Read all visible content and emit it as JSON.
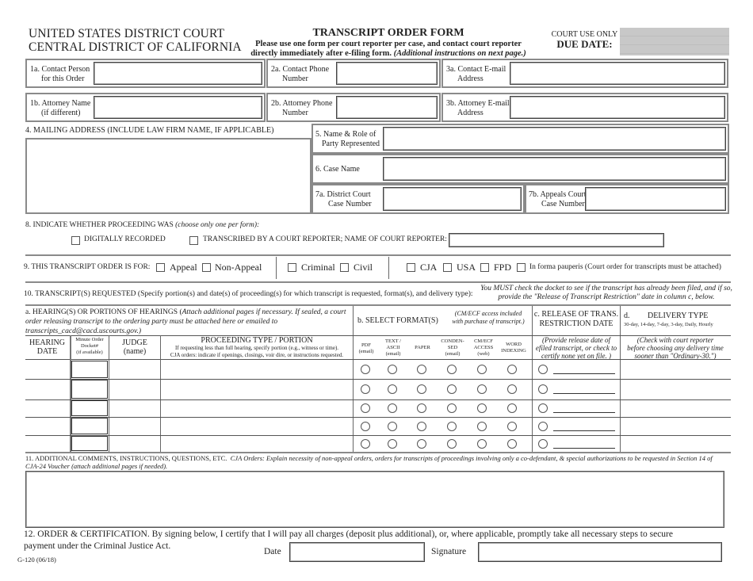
{
  "header": {
    "court_line1": "UNITED STATES DISTRICT COURT",
    "court_line2": "CENTRAL DISTRICT OF CALIFORNIA",
    "form_title": "TRANSCRIPT ORDER FORM",
    "instructions_line1": "Please use one form per court reporter per case, and contact court reporter",
    "instructions_line2": "directly immediately after e-filing form.",
    "instructions_italic": "(Additional instructions on next page.)",
    "court_use_only": "COURT USE ONLY",
    "due_date_label": "DUE DATE:"
  },
  "contact": {
    "f1a_line1": "1a.  Contact Person",
    "f1a_line2": "for this Order",
    "f2a_line1": "2a.  Contact Phone",
    "f2a_line2": "Number",
    "f3a_line1": "3a.  Contact E-mail",
    "f3a_line2": "Address",
    "f1b_line1": "1b.  Attorney Name",
    "f1b_line2": "(if different)",
    "f2b_line1": "2b.  Attorney Phone",
    "f2b_line2": "Number",
    "f3b_line1": "3b.  Attorney E-mail",
    "f3b_line2": "Address",
    "values": {
      "f1a": "",
      "f2a": "",
      "f3a": "",
      "f1b": "",
      "f2b": "",
      "f3b": ""
    }
  },
  "mailing": {
    "label": "4. MAILING ADDRESS (INCLUDE LAW FIRM NAME, IF APPLICABLE)",
    "value": ""
  },
  "party": {
    "f5_line1": "5. Name & Role of",
    "f5_line2": "Party Represented",
    "f6": "6.  Case Name",
    "f7a_line1": "7a.  District Court",
    "f7a_line2": "Case Number",
    "f7b_line1": "7b.  Appeals Court",
    "f7b_line2": "Case Number",
    "values": {
      "f5": "",
      "f6": "",
      "f7a": "",
      "f7b": ""
    }
  },
  "section8": {
    "label": "8.  INDICATE WHETHER PROCEEDING WAS",
    "label_italic": "(choose only one per form):",
    "opt_digital": "DIGITALLY RECORDED",
    "opt_reporter": "TRANSCRIBED BY A COURT REPORTER; NAME OF COURT REPORTER:",
    "reporter_name": "",
    "digital_checked": false,
    "reporter_checked": false
  },
  "section9": {
    "label": "9. THIS TRANSCRIPT ORDER IS FOR:",
    "options": [
      {
        "label": "Appeal",
        "checked": false
      },
      {
        "label": "Non-Appeal",
        "checked": false
      },
      {
        "label": "Criminal",
        "checked": false
      },
      {
        "label": "Civil",
        "checked": false
      },
      {
        "label": "CJA",
        "checked": false
      },
      {
        "label": "USA",
        "checked": false
      },
      {
        "label": "FPD",
        "checked": false
      },
      {
        "label": "In forma pauperis (Court order for transcripts must be attached)",
        "checked": false
      }
    ]
  },
  "section10": {
    "label": "10. TRANSCRIPT(S) REQUESTED (Specify portion(s) and date(s) of proceeding(s) for which transcript is requested, format(s), and delivery type):",
    "must_check_line1": "You MUST check the docket to see if the transcript has already been filed, and if so,",
    "must_check_line2": "provide the \"Release of Transcript Restriction\" date in column c, below.",
    "col_a_title": "a.  HEARING(S) OR PORTIONS OF HEARINGS (",
    "col_a_italic": "Attach additional pages if necessary.  If sealed, a court order releasing transcript to the ordering party must be attached here or emailed to transcripts_cacd@cacd.uscourts.gov.)",
    "col_b_title": "b.  SELECT FORMAT(S)",
    "col_b_note_line1": "(CM/ECF access included",
    "col_b_note_line2": "with purchase of transcript.)",
    "col_c_title_line1": "c.  RELEASE OF TRANS.",
    "col_c_title_line2": "RESTRICTION DATE",
    "col_d_title_letter": "d.",
    "col_d_title": "DELIVERY TYPE",
    "col_d_sub": "30-day, 14-day, 7-day, 3-day, Daily, Hourly",
    "headers": {
      "hearing_date_1": "HEARING",
      "hearing_date_2": "DATE",
      "minute_1": "Minute Order",
      "minute_2": "Docket#",
      "minute_3": "(if available)",
      "judge_1": "JUDGE",
      "judge_2": "(name)",
      "proc_title": "PROCEEDING TYPE / PORTION",
      "proc_sub1": "If requesting less than full hearing, specify portion (e.g., witness or time).",
      "proc_sub2": "CJA orders: indicate if openings, closings, voir dire, or instructions requested.",
      "pdf_1": "PDF",
      "pdf_2": "(email)",
      "text_1": "TEXT /",
      "text_2": "ASCII",
      "text_3": "(email)",
      "paper": "PAPER",
      "cond_1": "CONDEN-",
      "cond_2": "SED",
      "cond_3": "(email)",
      "cmecf_1": "CM/ECF",
      "cmecf_2": "ACCESS",
      "cmecf_3": "(web)",
      "word_1": "WORD",
      "word_2": "INDEXING",
      "release_1": "(Provide release date of",
      "release_2": "efiled transcript, or check to",
      "release_3": "certify none yet on file. )",
      "delivery_1": "(Check with court reporter",
      "delivery_2": "before choosing any delivery time",
      "delivery_3": "sooner than \"Ordinary-30.\")"
    },
    "rows": [
      {
        "hearing_date": "",
        "minute_order": "",
        "judge": "",
        "proceeding": "",
        "formats": [
          false,
          false,
          false,
          false,
          false,
          false
        ],
        "release_none": false,
        "release_date": "",
        "delivery": ""
      },
      {
        "hearing_date": "",
        "minute_order": "",
        "judge": "",
        "proceeding": "",
        "formats": [
          false,
          false,
          false,
          false,
          false,
          false
        ],
        "release_none": false,
        "release_date": "",
        "delivery": ""
      },
      {
        "hearing_date": "",
        "minute_order": "",
        "judge": "",
        "proceeding": "",
        "formats": [
          false,
          false,
          false,
          false,
          false,
          false
        ],
        "release_none": false,
        "release_date": "",
        "delivery": ""
      },
      {
        "hearing_date": "",
        "minute_order": "",
        "judge": "",
        "proceeding": "",
        "formats": [
          false,
          false,
          false,
          false,
          false,
          false
        ],
        "release_none": false,
        "release_date": "",
        "delivery": ""
      },
      {
        "hearing_date": "",
        "minute_order": "",
        "judge": "",
        "proceeding": "",
        "formats": [
          false,
          false,
          false,
          false,
          false,
          false
        ],
        "release_none": false,
        "release_date": "",
        "delivery": ""
      }
    ]
  },
  "section11": {
    "label": "11. ADDITIONAL COMMENTS, INSTRUCTIONS, QUESTIONS, ETC.",
    "label_italic": "CJA Orders:  Explain necessity of non-appeal orders, orders for transcripts of proceedings involving only a co-defendant, & special authorizations to be requested in Section 14 of CJA-24 Voucher (attach additional pages if needed).",
    "value": ""
  },
  "section12": {
    "text_line1": "12.  ORDER & CERTIFICATION.  By signing below, I certify that I will pay all charges (deposit plus additional), or, where applicable, promptly take all necessary steps to secure",
    "text_line2": "payment under the Criminal Justice Act.",
    "date_label": "Date",
    "signature_label": "Signature",
    "date_value": "",
    "signature_value": ""
  },
  "footer": {
    "form_code": "G-120 (06/18)"
  }
}
